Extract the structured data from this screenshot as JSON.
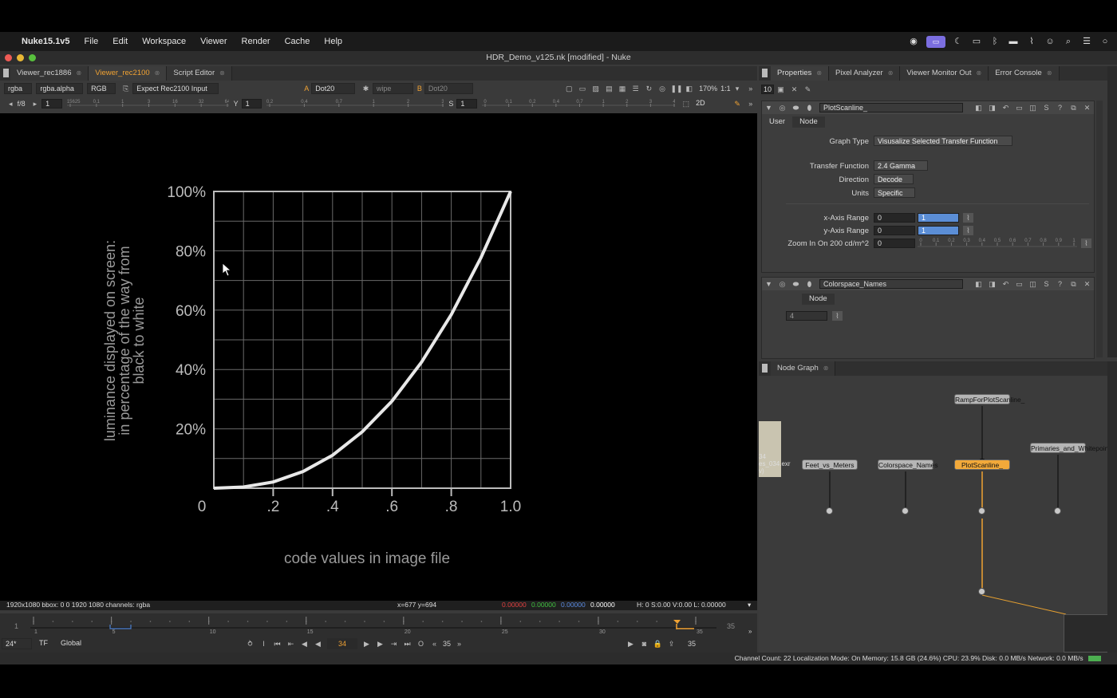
{
  "menubar": {
    "app_name": "Nuke15.1v5",
    "items": [
      "File",
      "Edit",
      "Workspace",
      "Viewer",
      "Render",
      "Cache",
      "Help"
    ]
  },
  "window": {
    "title": "HDR_Demo_v125.nk [modified] - Nuke"
  },
  "viewer_tabs": [
    {
      "label": "Viewer_rec1886"
    },
    {
      "label": "Viewer_rec2100"
    },
    {
      "label": "Script Editor"
    }
  ],
  "viewer_toolbar": {
    "channels": "rgba",
    "alpha": "rgba.alpha",
    "colorspace": "RGB",
    "input_process": "Expect Rec2100 Input",
    "a_label": "A",
    "a_input": "Dot20",
    "wipe": "wipe",
    "b_label": "B",
    "b_input": "Dot20",
    "zoom": "170%",
    "ratio": "1:1"
  },
  "viewer_toolbar2": {
    "fstop": "f/8",
    "gain": "1",
    "y_label": "Y",
    "gamma": "1",
    "s_label": "S",
    "saturation": "1",
    "view_mode": "2D",
    "gain_ticks": [
      "0.015625",
      "0.1",
      "1",
      "3",
      "16",
      "32",
      "64"
    ],
    "gamma_ticks": [
      "0.2",
      "0.4",
      "0.7",
      "1",
      "2",
      "3"
    ],
    "sat_ticks": [
      "0",
      "0.1",
      "0.2",
      "0.4",
      "0.7",
      "1",
      "2",
      "3",
      "4"
    ]
  },
  "viewer_status": {
    "format": "1920x1080  bbox: 0 0 1920 1080 channels: rgba",
    "coords": "x=677 y=694",
    "r": "0.00000",
    "g": "0.00000",
    "b": "0.00000",
    "a": "0.00000",
    "hsvl": "H:  0 S:0.00 V:0.00   L: 0.00000"
  },
  "chart_data": {
    "type": "line",
    "title": "",
    "xlabel": "code values in image file",
    "ylabel": "luminance displayed on screen: in percentage of the way from black to white",
    "ylabel_lines": [
      "luminance displayed on screen:",
      "in percentage of the way from",
      "black to white"
    ],
    "x_tick_labels": [
      "0",
      ".2",
      ".4",
      ".6",
      ".8",
      "1.0"
    ],
    "y_tick_labels": [
      "20%",
      "40%",
      "60%",
      "80%",
      "100%"
    ],
    "xlim": [
      0,
      1
    ],
    "ylim": [
      0,
      1
    ],
    "grid": true,
    "series": [
      {
        "x": [
          0,
          0.1,
          0.2,
          0.3,
          0.4,
          0.5,
          0.6,
          0.7,
          0.8,
          0.9,
          1.0
        ],
        "y": [
          0,
          0.004,
          0.021,
          0.056,
          0.111,
          0.19,
          0.293,
          0.425,
          0.585,
          0.777,
          1.0
        ]
      }
    ]
  },
  "timeline": {
    "start": "1",
    "end": "35",
    "ticks": [
      "1",
      "5",
      "10",
      "15",
      "20",
      "25",
      "30",
      "35"
    ],
    "fps": "24*",
    "tf": "TF",
    "scope": "Global",
    "current_frame": "34",
    "step": "35",
    "end_frame": "35"
  },
  "right_tabs": [
    {
      "label": "Properties"
    },
    {
      "label": "Pixel Analyzer"
    },
    {
      "label": "Viewer Monitor Out"
    },
    {
      "label": "Error Console"
    }
  ],
  "properties": {
    "max_panels": "10",
    "node1": {
      "name": "PlotScanline_",
      "tabs": [
        "User",
        "Node"
      ],
      "graph_type_label": "Graph Type",
      "graph_type": "Visusalize Selected Transfer Function",
      "transfer_function_label": "Transfer Function",
      "transfer_function": "2.4 Gamma",
      "direction_label": "Direction",
      "direction": "Decode",
      "units_label": "Units",
      "units": "Specific",
      "x_range_label": "x-Axis Range",
      "x_range_min": "0",
      "x_range_max": "1",
      "y_range_label": "y-Axis Range",
      "y_range_min": "0",
      "y_range_max": "1",
      "zoom_label": "Zoom In On 200 cd/m^2",
      "zoom_value": "0",
      "zoom_ticks": [
        "0",
        "0.1",
        "0.2",
        "0.3",
        "0.4",
        "0.5",
        "0.6",
        "0.7",
        "0.8",
        "0.9",
        "1"
      ]
    },
    "node2": {
      "name": "Colorspace_Names",
      "tab": "Node",
      "value": "4"
    }
  },
  "node_graph": {
    "tab": "Node Graph",
    "nodes": {
      "ramp": "RampForPlotScanline_",
      "feet": "Feet_vs_Meters",
      "colorspace": "Colorspace_Names",
      "plot": "PlotScanline_",
      "primaries": "Primaries_and_Whitepoint",
      "read_label_1": "34",
      "read_label_2": "es_034.exr",
      "read_label_3": "v)"
    }
  },
  "statusbar": {
    "text": "Channel Count: 22  Localization Mode: On  Memory: 15.8 GB (24.6%)  CPU: 23.9%  Disk: 0.0 MB/s  Network: 0.0 MB/s"
  },
  "colors": {
    "accent": "#f0a233",
    "selected_node": "#f2a93a",
    "field_highlight": "#5b8ed6"
  }
}
